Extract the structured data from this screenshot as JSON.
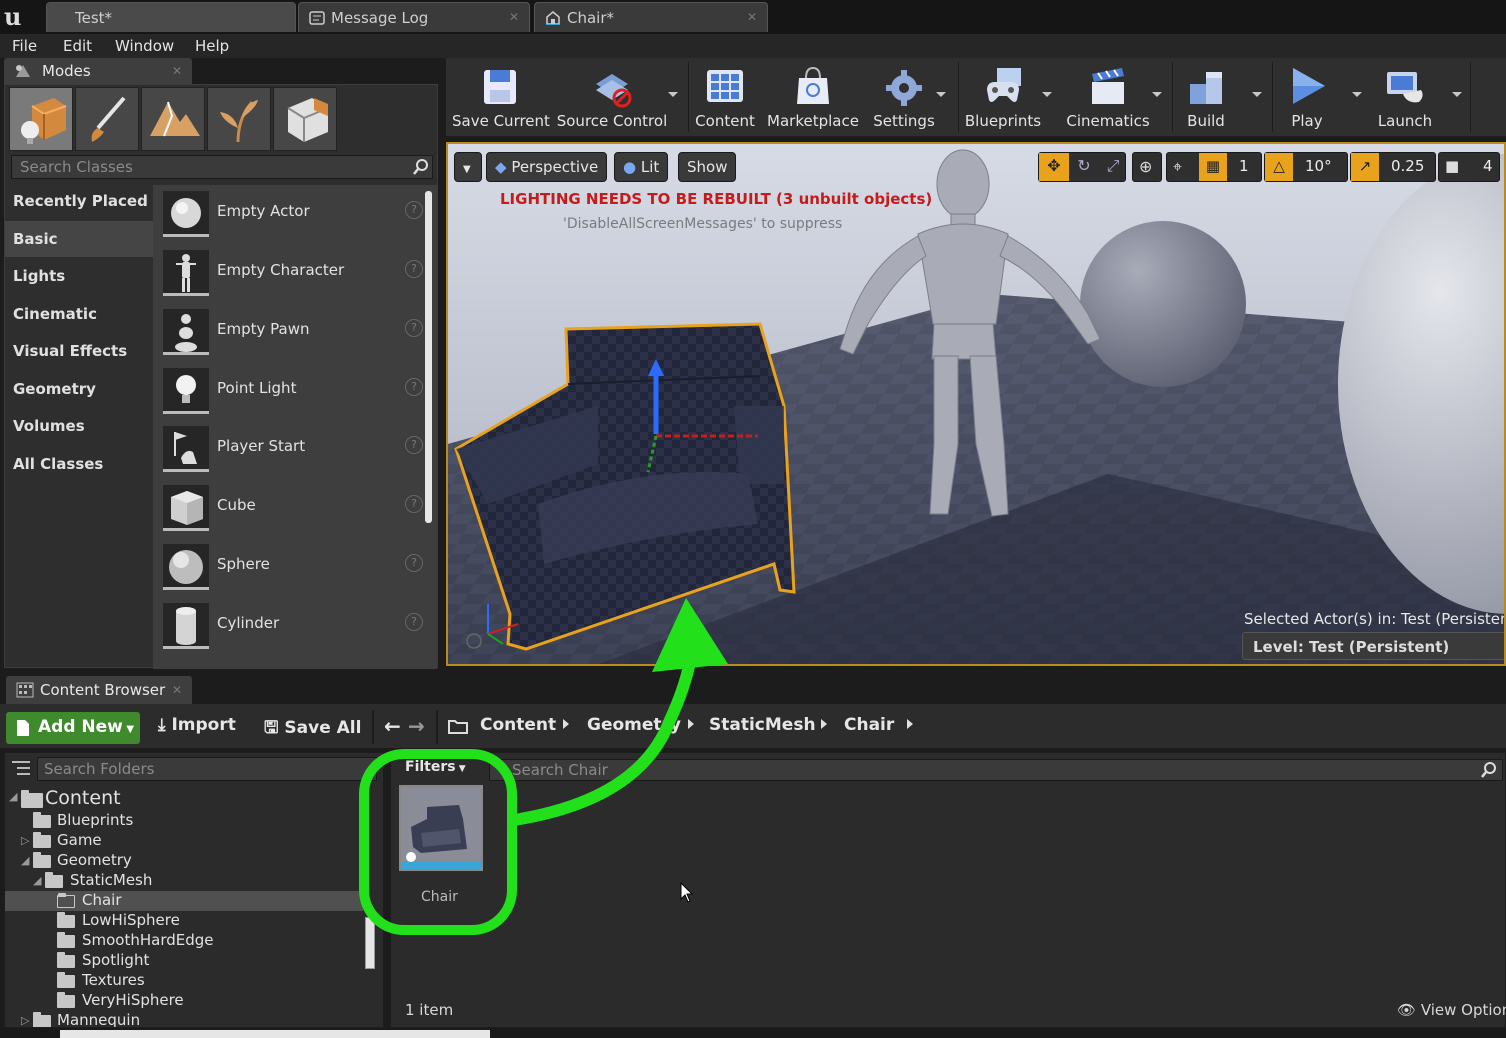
{
  "tabs": [
    {
      "label": "Test*"
    },
    {
      "label": "Message Log"
    },
    {
      "label": "Chair*"
    }
  ],
  "menu": [
    "File",
    "Edit",
    "Window",
    "Help"
  ],
  "modes": {
    "title": "Modes",
    "search_placeholder": "Search Classes",
    "categories": [
      "Recently Placed",
      "Basic",
      "Lights",
      "Cinematic",
      "Visual Effects",
      "Geometry",
      "Volumes",
      "All Classes"
    ],
    "active_category": "Basic",
    "items": [
      "Empty Actor",
      "Empty Character",
      "Empty Pawn",
      "Point Light",
      "Player Start",
      "Cube",
      "Sphere",
      "Cylinder"
    ]
  },
  "toolbar": {
    "buttons": [
      "Save Current",
      "Source Control",
      "Content",
      "Marketplace",
      "Settings",
      "Blueprints",
      "Cinematics",
      "Build",
      "Play",
      "Launch"
    ]
  },
  "viewport": {
    "perspective": "Perspective",
    "lit": "Lit",
    "show": "Show",
    "warning": "LIGHTING NEEDS TO BE REBUILT (3 unbuilt objects)",
    "suppress": "'DisableAllScreenMessages' to suppress",
    "grid_value": "1",
    "rotation_snap": "10°",
    "scale_snap": "0.25",
    "camera_speed": "4",
    "selected_text": "Selected Actor(s) in:  Test (Persistent)",
    "level_text": "Level:  Test (Persistent)"
  },
  "content_browser": {
    "title": "Content Browser",
    "add_new": "Add New",
    "import": "Import",
    "save_all": "Save All",
    "breadcrumb": [
      "Content",
      "Geometry",
      "StaticMesh",
      "Chair"
    ],
    "search_folders_placeholder": "Search Folders",
    "filters": "Filters",
    "search_assets_placeholder": "Search Chair",
    "tree": [
      {
        "label": "Content",
        "level": 0,
        "expanded": true
      },
      {
        "label": "Blueprints",
        "level": 1
      },
      {
        "label": "Game",
        "level": 1,
        "collapsed": true
      },
      {
        "label": "Geometry",
        "level": 1,
        "expanded": true
      },
      {
        "label": "StaticMesh",
        "level": 2,
        "expanded": true
      },
      {
        "label": "Chair",
        "level": 3,
        "selected": true
      },
      {
        "label": "LowHiSphere",
        "level": 3
      },
      {
        "label": "SmoothHardEdge",
        "level": 3
      },
      {
        "label": "Spotlight",
        "level": 3
      },
      {
        "label": "Textures",
        "level": 3
      },
      {
        "label": "VeryHiSphere",
        "level": 3
      },
      {
        "label": "Mannequin",
        "level": 1,
        "collapsed": true
      }
    ],
    "asset_label": "Chair",
    "item_count": "1 item",
    "view_options": "View Options"
  },
  "colors": {
    "highlight_green": "#22e01a",
    "selection_orange": "#e8a21c",
    "add_new_green": "#3e8a2d",
    "warning_red": "#c41b1b"
  }
}
